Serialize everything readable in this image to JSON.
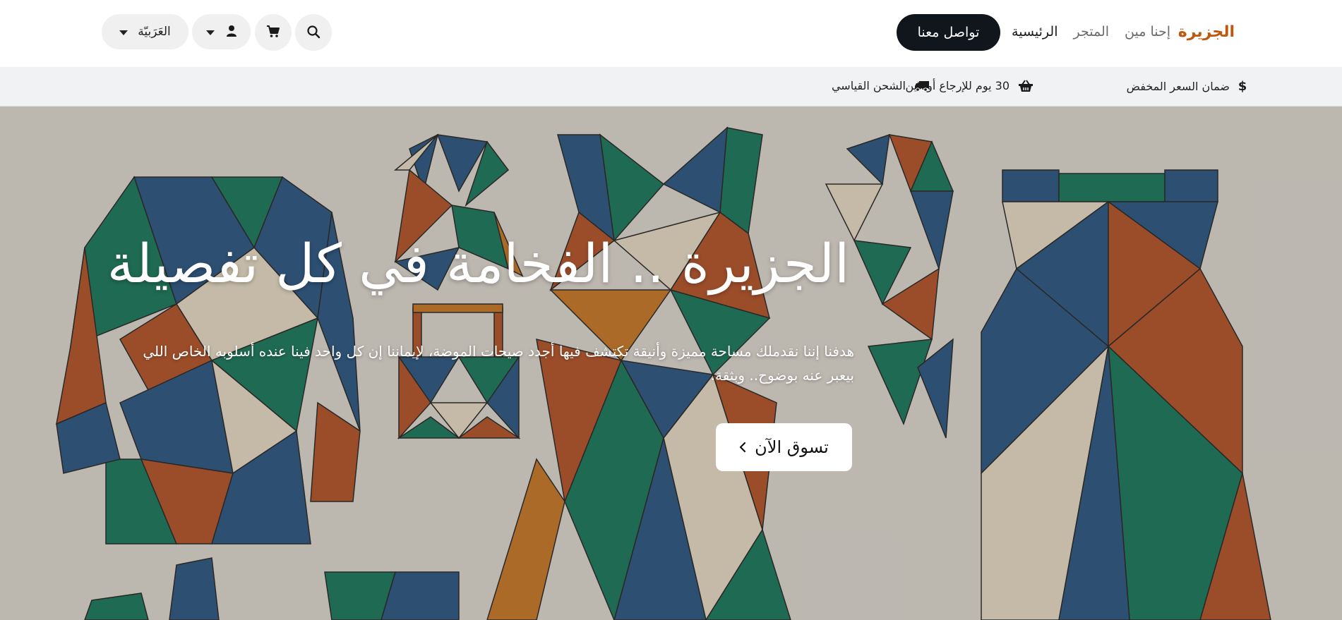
{
  "header": {
    "logo_text": "الجزيرة",
    "nav": [
      {
        "label": "الرئيسية",
        "active": true
      },
      {
        "label": "المتجر",
        "active": false
      },
      {
        "label": "إحنا مين",
        "active": false
      }
    ],
    "contact_label": "تواصل معنا",
    "language_label": "العَرَبيّة",
    "icons": [
      "search-icon",
      "cart-icon",
      "user-icon",
      "chevron-down-icon"
    ]
  },
  "features": [
    {
      "label": "ضمان السعر المخفض",
      "icon": "dollar-icon"
    },
    {
      "label": "30 يوم للإرجاع أونلاين",
      "icon": "basket-icon"
    },
    {
      "label": "الشحن القياسي",
      "icon": "truck-icon"
    }
  ],
  "hero": {
    "title": "الجزيرة .. الفخامة في كل تفصيلة",
    "description": "هدفنا إننا نقدملك مساحة مميزة وأنيقة تكتشف فيها أجدد صيحات الموضة، لإيماننا إن كل واحد فينا عنده أسلوبه الخاص اللي بيعبر عنه بوضوح.. وبثقة.",
    "cta_label": "تسوق الآن"
  },
  "colors": {
    "brand": "#c0570e",
    "button_dark": "#11151c",
    "strip_bg": "#f1f2f4",
    "pill_bg": "#f0f0f0"
  }
}
